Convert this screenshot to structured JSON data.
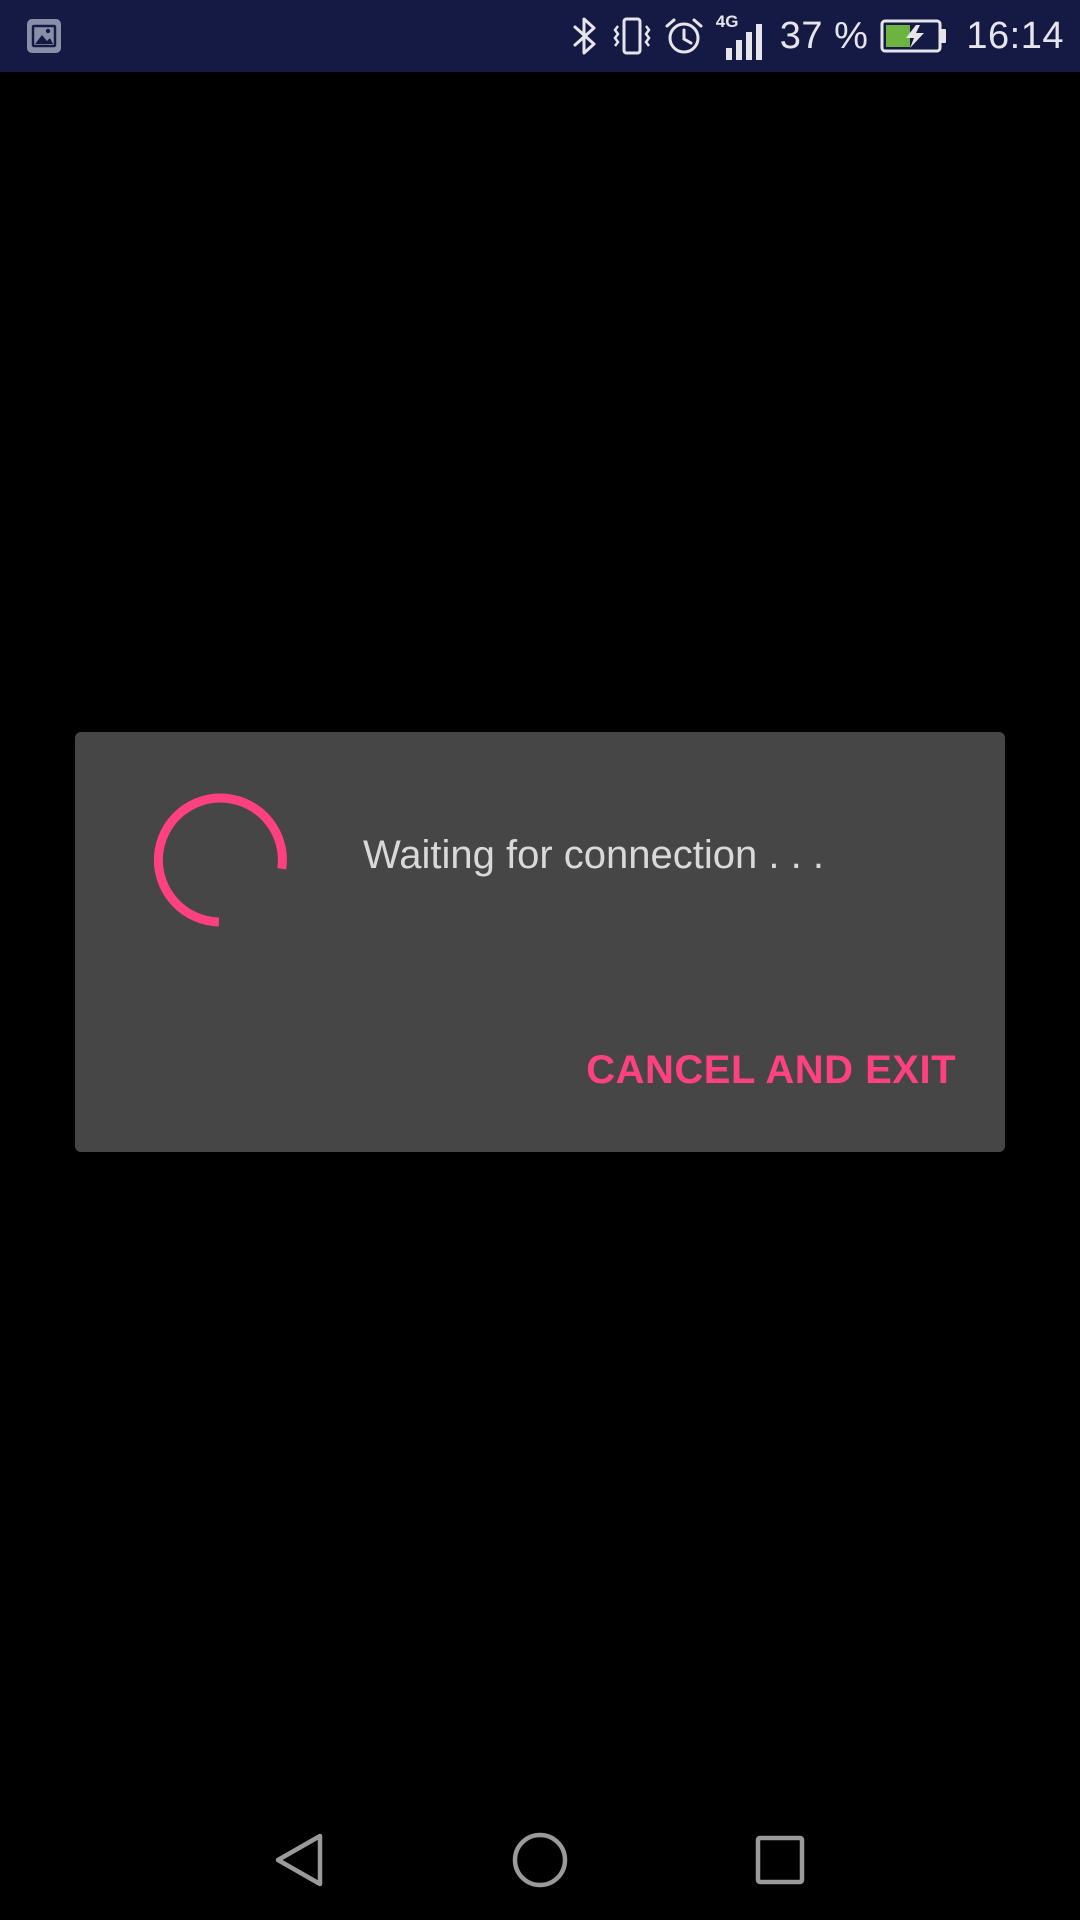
{
  "status_bar": {
    "network_label": "4G",
    "battery_percent": "37 %",
    "time": "16:14",
    "icons": [
      "gallery-icon",
      "bluetooth-icon",
      "vibrate-icon",
      "alarm-icon",
      "signal-icon",
      "battery-charging-icon"
    ]
  },
  "dialog": {
    "message": "Waiting for connection . . .",
    "cancel_label": "CANCEL AND EXIT"
  },
  "nav_bar": {
    "icons": [
      "back-icon",
      "home-icon",
      "recents-icon"
    ]
  },
  "colors": {
    "accent": "#ff4081",
    "status_bar_bg": "#141a44",
    "dialog_bg": "#464646",
    "dialog_text": "#d9d9d9",
    "battery_fill": "#6cb33f"
  }
}
